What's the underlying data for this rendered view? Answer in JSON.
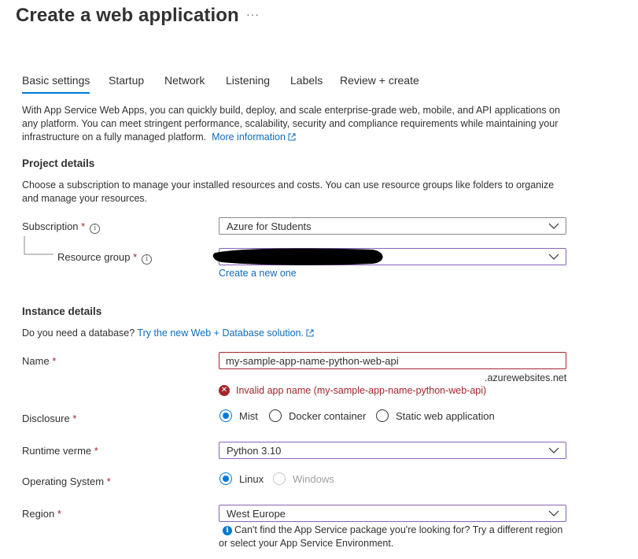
{
  "header": {
    "title": "Create a web application",
    "more": "···"
  },
  "tabs": [
    "Basic settings",
    "Startup",
    "Network",
    "Listening",
    "Labels",
    "Review + create"
  ],
  "intro": {
    "text": "With App Service Web Apps, you can quickly build, deploy, and scale enterprise-grade web, mobile, and API applications on any platform. You can meet stringent performance, scalability, security and compliance requirements while maintaining your infrastructure on a fully managed platform.",
    "link": "More information"
  },
  "project": {
    "heading": "Project details",
    "description": "Choose a subscription to manage your installed resources and costs. You can use resource groups like folders to organize and manage your resources.",
    "subscription_label": "Subscription",
    "subscription_value": "Azure for Students",
    "resource_group_label": "Resource group",
    "resource_group_value": "",
    "create_new": "Create a new one"
  },
  "instance": {
    "heading": "Instance details",
    "db_question": "Do you need a database?",
    "db_link": "Try the new Web + Database solution.",
    "name_label": "Name",
    "name_value": "my-sample-app-name-python-web-api",
    "name_suffix": ".azurewebsites.net",
    "name_error": "Invalid app name (my-sample-app-name-python-web-api)",
    "disclosure_label": "Disclosure",
    "disclosure_options": [
      "Mist",
      "Docker container",
      "Static web application"
    ],
    "runtime_label": "Runtime verme",
    "runtime_value": "Python 3.10",
    "os_label": "Operating System",
    "os_options": [
      "Linux",
      "Windows"
    ],
    "region_label": "Region",
    "region_value": "West Europe",
    "region_note": "Can't find the App Service package you're looking for? Try a different region or select your App Service Environment."
  },
  "required_mark": "*",
  "colors": {
    "accent": "#0078d4",
    "error": "#a4262c",
    "link": "#0f6cbd",
    "dropdown_focus_border": "#8764b8"
  }
}
